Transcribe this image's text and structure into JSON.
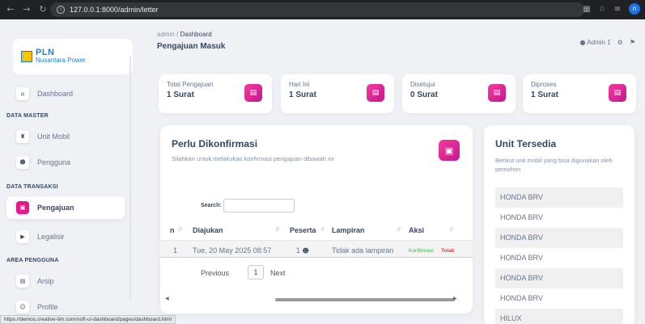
{
  "browser": {
    "url": "127.0.0.1:8000/admin/letter",
    "status_url": "https://demos.creative-tim.com/soft-ui-dashboard/pages/dashboard.html",
    "profile_initial": "n"
  },
  "sidebar": {
    "brand": {
      "name": "PLN",
      "tagline": "Nusantara Power"
    },
    "sections": {
      "master": "DATA MASTER",
      "transaksi": "DATA TRANSAKSI",
      "pengguna": "AREA PENGGUNA"
    },
    "items": [
      {
        "label": "Dashboard",
        "icon": "home-icon"
      },
      {
        "label": "Unit Mobil",
        "icon": "car-icon"
      },
      {
        "label": "Pengguna",
        "icon": "users-icon"
      },
      {
        "label": "Pengajuan",
        "icon": "inbox-icon",
        "active": true
      },
      {
        "label": "Legalisir",
        "icon": "stamp-icon"
      },
      {
        "label": "Arsip",
        "icon": "folder-icon"
      },
      {
        "label": "Profile",
        "icon": "profile-icon"
      }
    ]
  },
  "header": {
    "breadcrumb_root": "admin",
    "breadcrumb_sep": "/",
    "breadcrumb_current": "Dashboard",
    "title": "Pengajuan Masuk",
    "user": "Admin 1"
  },
  "stats": [
    {
      "label": "Total Pengajuan",
      "value": "1 Surat"
    },
    {
      "label": "Hari Ini",
      "value": "1 Surat"
    },
    {
      "label": "Disetujui",
      "value": "0 Surat"
    },
    {
      "label": "Diproses",
      "value": "1 Surat"
    }
  ],
  "confirm": {
    "title": "Perlu Dikonfirmasi",
    "subtitle": "Silahkan untuk melakukan konfirmasi pengajuan dibawah ini",
    "search_label": "Search:",
    "search_value": "",
    "columns": [
      "n",
      "Diajukan",
      "Peserta",
      "Lampiran",
      "Aksi"
    ],
    "rows": [
      {
        "no": "1",
        "diajukan": "Tue, 20 May 2025 08:57",
        "peserta": "1",
        "lampiran": "Tidak ada lampiran",
        "confirm": "Konfirmasi",
        "reject": "Tolak"
      }
    ],
    "pager": {
      "prev": "Previous",
      "page": "1",
      "next": "Next"
    }
  },
  "units": {
    "title": "Unit Tersedia",
    "subtitle": "Berikut unit mobil yang bisa digunakan oleh pemohon",
    "items": [
      "HONDA BRV",
      "HONDA BRV",
      "HONDA BRV",
      "HONDA BRV",
      "HONDA BRV",
      "HONDA BRV",
      "HILUX"
    ]
  }
}
